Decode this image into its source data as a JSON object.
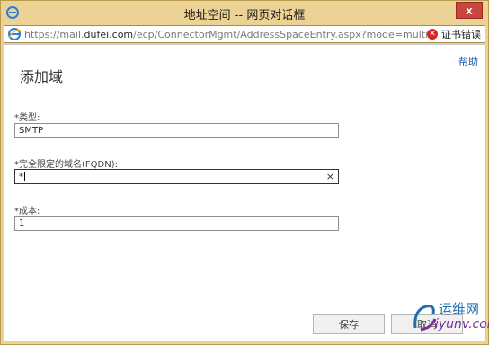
{
  "window": {
    "title": "地址空间 -- 网页对话框",
    "close_glyph": "x"
  },
  "addressbar": {
    "url_prefix": "https://mail.",
    "url_domain": "dufei.com",
    "url_rest": "/ecp/ConnectorMgmt/AddressSpaceEntry.aspx?mode=multiple&new=tr",
    "cert_error": "证书错误"
  },
  "page": {
    "help_label": "帮助",
    "title": "添加域"
  },
  "form": {
    "type_label": "*类型:",
    "type_value": "SMTP",
    "fqdn_label": "*完全限定的域名(FQDN):",
    "fqdn_value": "*",
    "clear_glyph": "×",
    "cost_label": "*成本:",
    "cost_value": "1"
  },
  "buttons": {
    "save": "保存",
    "cancel": "取消"
  },
  "watermark": {
    "top": "运维网",
    "bottom": "iyunv.com"
  }
}
